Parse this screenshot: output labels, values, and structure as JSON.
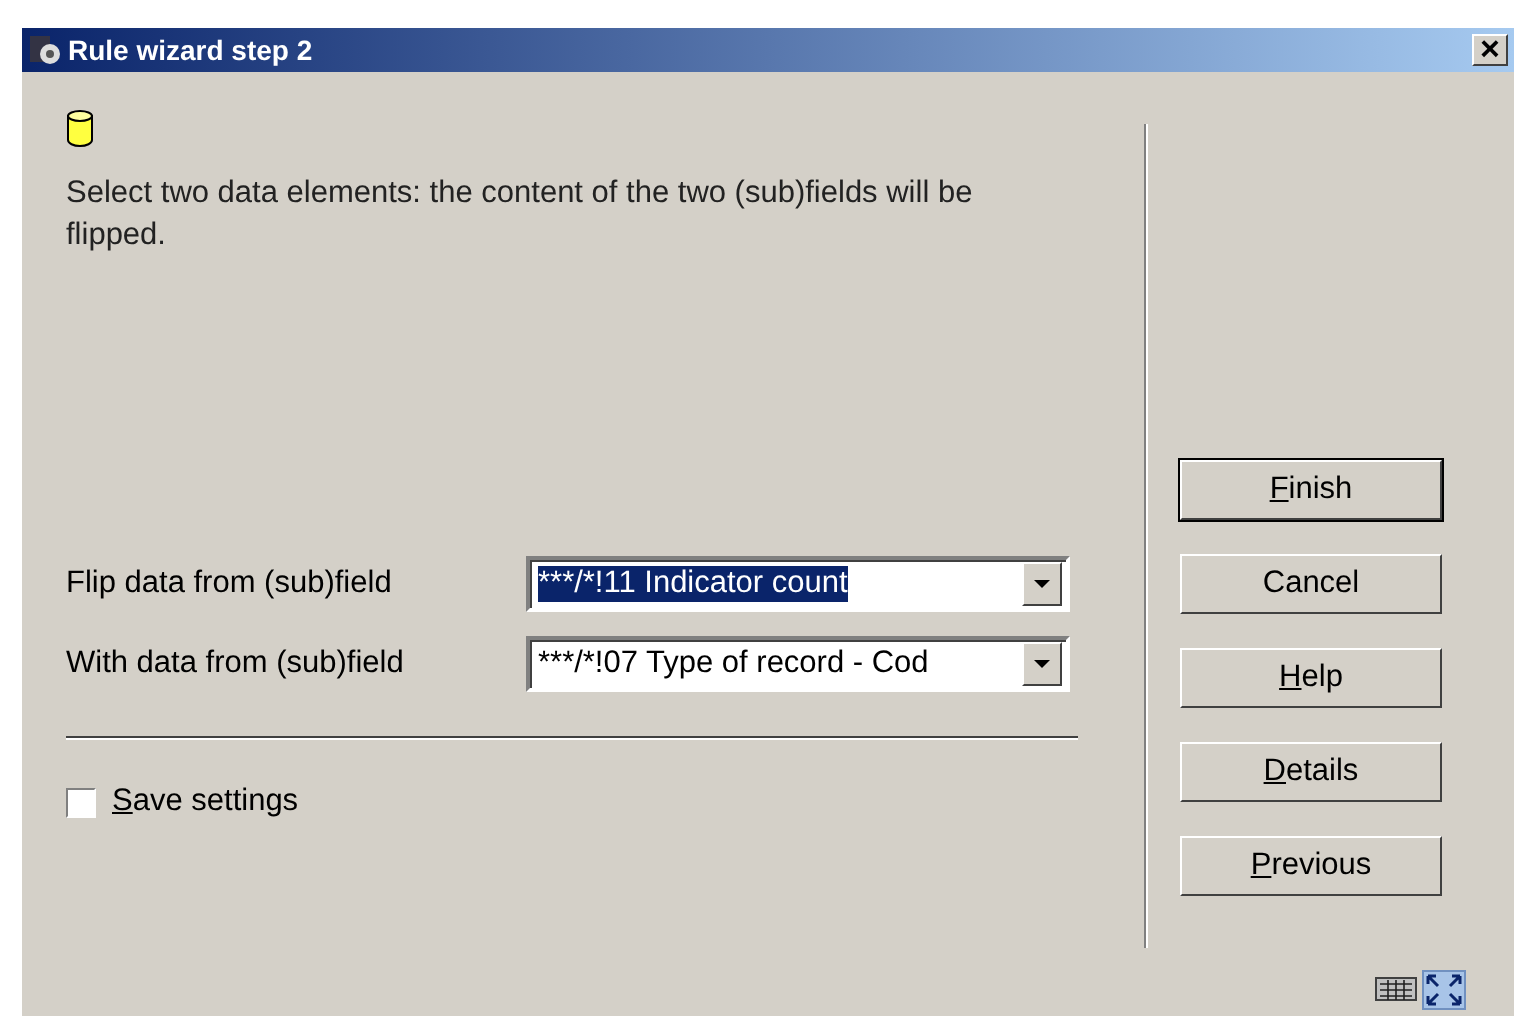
{
  "window": {
    "title": "Rule wizard step 2",
    "close": "×"
  },
  "instruction": "Select two data elements: the content of the two (sub)fields will be flipped.",
  "fields": [
    {
      "label": "Flip data from (sub)field",
      "value": "***/*!11 Indicator count",
      "selected": true
    },
    {
      "label": "With data from (sub)field",
      "value": "***/*!07 Type of record - Cod",
      "selected": false
    }
  ],
  "save_settings": {
    "label": "Save settings",
    "checked": false,
    "underline_first": true
  },
  "buttons": [
    {
      "label": "Finish",
      "default": true,
      "underline_first": true
    },
    {
      "label": "Cancel",
      "default": false,
      "underline_first": false
    },
    {
      "label": "Help",
      "default": false,
      "underline_first": true
    },
    {
      "label": "Details",
      "default": false,
      "underline_first": true
    },
    {
      "label": "Previous",
      "default": false,
      "underline_first": true
    }
  ]
}
